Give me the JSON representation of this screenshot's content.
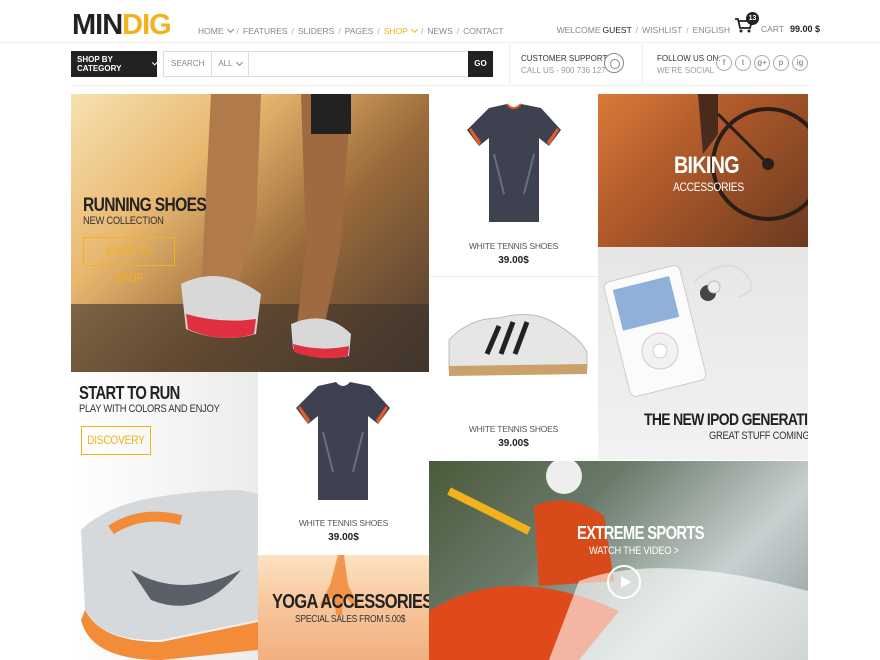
{
  "brand": {
    "logo_part1": "MIN",
    "logo_part2": "DIG"
  },
  "nav": {
    "items": [
      {
        "label": "HOME",
        "has_dropdown": true
      },
      {
        "label": "FEATURES",
        "has_dropdown": false
      },
      {
        "label": "SLIDERS",
        "has_dropdown": false
      },
      {
        "label": "PAGES",
        "has_dropdown": false
      },
      {
        "label": "SHOP",
        "has_dropdown": true,
        "active": true
      },
      {
        "label": "NEWS",
        "has_dropdown": false
      },
      {
        "label": "CONTACT",
        "has_dropdown": false
      }
    ],
    "separator": "/"
  },
  "account": {
    "welcome": "WELCOME",
    "user": "GUEST",
    "wishlist": "WISHLIST",
    "language": "ENGLISH"
  },
  "cart": {
    "count": "13",
    "label": "CART",
    "total": "99.00 $"
  },
  "search": {
    "category_button": "SHOP BY CATEGORY",
    "label": "SEARCH",
    "scope": "ALL",
    "placeholder": "",
    "go": "GO"
  },
  "support": {
    "title": "CUSTOMER SUPPORT",
    "phone": "CALL US - 900 736 127"
  },
  "follow": {
    "title": "FOLLOW US ON:",
    "subtitle": "WE'RE SOCIAL",
    "networks": [
      "f",
      "t",
      "g+",
      "p",
      "ig"
    ]
  },
  "tiles": {
    "running": {
      "title": "RUNNING SHOES",
      "subtitle": "NEW COLLECTION",
      "button": "START TO SHOP"
    },
    "product1": {
      "name": "WHITE TENNIS SHOES",
      "price": "39.00$"
    },
    "biking": {
      "title": "BIKING",
      "subtitle": "ACCESSORIES"
    },
    "product2": {
      "name": "WHITE TENNIS SHOES",
      "price": "39.00$"
    },
    "ipod": {
      "title": "THE NEW IPOD GENERATION",
      "subtitle": "GREAT STUFF COMING!"
    },
    "start_run": {
      "title": "START TO RUN",
      "subtitle": "PLAY WITH COLORS AND ENJOY",
      "button": "DISCOVERY"
    },
    "product3": {
      "name": "WHITE TENNIS SHOES",
      "price": "39.00$"
    },
    "yoga": {
      "title": "YOGA ACCESSORIES",
      "subtitle": "SPECIAL SALES FROM 5.00$"
    },
    "extreme": {
      "title": "EXTREME SPORTS",
      "subtitle": "WATCH THE VIDEO >"
    }
  },
  "colors": {
    "accent": "#f2b21b",
    "dark": "#222222"
  }
}
